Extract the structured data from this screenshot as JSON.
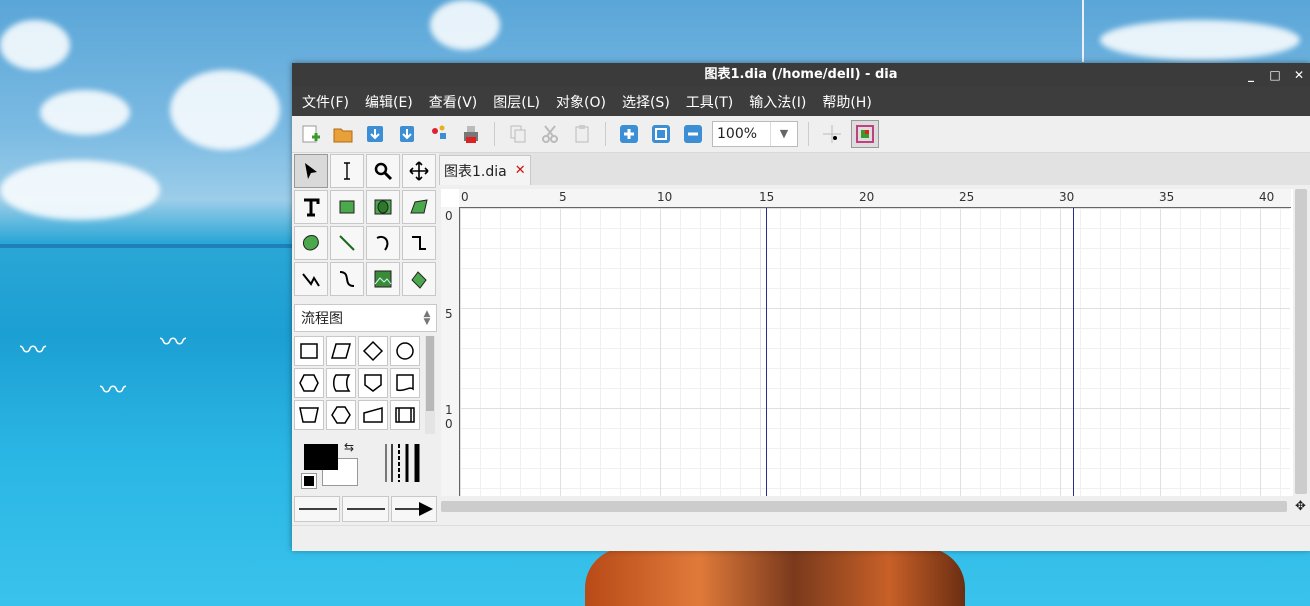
{
  "window": {
    "title": "图表1.dia (/home/dell) - dia",
    "controls": [
      "_",
      "□",
      "✕"
    ]
  },
  "menu": [
    "文件(F)",
    "编辑(E)",
    "查看(V)",
    "图层(L)",
    "对象(O)",
    "选择(S)",
    "工具(T)",
    "输入法(I)",
    "帮助(H)"
  ],
  "toolbar": {
    "zoom_value": "100%"
  },
  "toolbox": {
    "sheet_label": "流程图"
  },
  "document": {
    "tab_label": "图表1.dia",
    "tab_close": "✕",
    "hruler": [
      "0",
      "5",
      "10",
      "15",
      "20",
      "25",
      "30",
      "35",
      "40"
    ],
    "vruler": [
      "0",
      "5",
      "1",
      "0"
    ]
  },
  "colors": {
    "foreground": "#000000",
    "background": "#ffffff",
    "accent": "#3c8fd4"
  }
}
